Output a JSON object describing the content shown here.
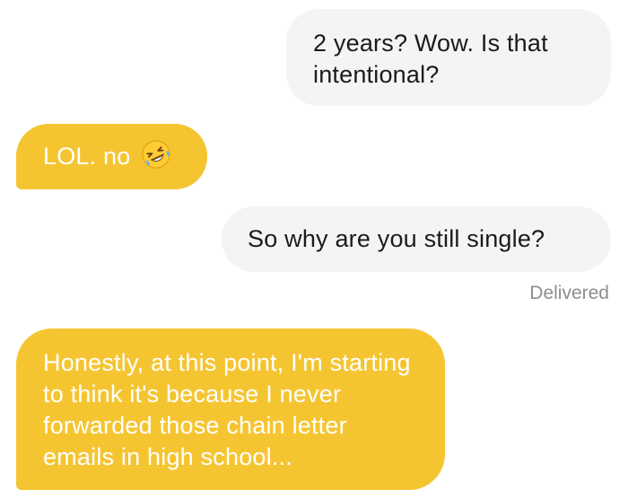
{
  "conversation": {
    "messages": [
      {
        "sender": "me",
        "text": "2 years? Wow. Is that intentional?"
      },
      {
        "sender": "match",
        "text": "LOL. no",
        "emoji": "rolling-on-floor-laughing-icon"
      },
      {
        "sender": "me",
        "text": "So why are you still single?"
      },
      {
        "sender": "match",
        "text": "Honestly, at this point, I'm starting to think it's because I never forwarded those chain letter emails in high school..."
      }
    ],
    "status": "Delivered"
  },
  "colors": {
    "sent_bubble": "#f4f4f4",
    "received_bubble": "#f5c531",
    "status_text": "#8e8e8e"
  }
}
